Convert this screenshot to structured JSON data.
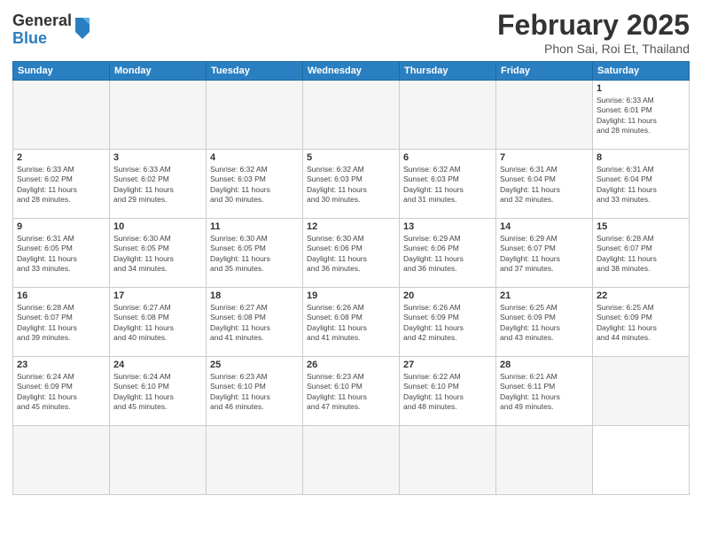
{
  "logo": {
    "general": "General",
    "blue": "Blue"
  },
  "title": "February 2025",
  "subtitle": "Phon Sai, Roi Et, Thailand",
  "weekdays": [
    "Sunday",
    "Monday",
    "Tuesday",
    "Wednesday",
    "Thursday",
    "Friday",
    "Saturday"
  ],
  "days": [
    {
      "num": "",
      "info": ""
    },
    {
      "num": "",
      "info": ""
    },
    {
      "num": "",
      "info": ""
    },
    {
      "num": "",
      "info": ""
    },
    {
      "num": "",
      "info": ""
    },
    {
      "num": "",
      "info": ""
    },
    {
      "num": "1",
      "info": "Sunrise: 6:33 AM\nSunset: 6:01 PM\nDaylight: 11 hours\nand 28 minutes."
    },
    {
      "num": "2",
      "info": "Sunrise: 6:33 AM\nSunset: 6:02 PM\nDaylight: 11 hours\nand 28 minutes."
    },
    {
      "num": "3",
      "info": "Sunrise: 6:33 AM\nSunset: 6:02 PM\nDaylight: 11 hours\nand 29 minutes."
    },
    {
      "num": "4",
      "info": "Sunrise: 6:32 AM\nSunset: 6:03 PM\nDaylight: 11 hours\nand 30 minutes."
    },
    {
      "num": "5",
      "info": "Sunrise: 6:32 AM\nSunset: 6:03 PM\nDaylight: 11 hours\nand 30 minutes."
    },
    {
      "num": "6",
      "info": "Sunrise: 6:32 AM\nSunset: 6:03 PM\nDaylight: 11 hours\nand 31 minutes."
    },
    {
      "num": "7",
      "info": "Sunrise: 6:31 AM\nSunset: 6:04 PM\nDaylight: 11 hours\nand 32 minutes."
    },
    {
      "num": "8",
      "info": "Sunrise: 6:31 AM\nSunset: 6:04 PM\nDaylight: 11 hours\nand 33 minutes."
    },
    {
      "num": "9",
      "info": "Sunrise: 6:31 AM\nSunset: 6:05 PM\nDaylight: 11 hours\nand 33 minutes."
    },
    {
      "num": "10",
      "info": "Sunrise: 6:30 AM\nSunset: 6:05 PM\nDaylight: 11 hours\nand 34 minutes."
    },
    {
      "num": "11",
      "info": "Sunrise: 6:30 AM\nSunset: 6:05 PM\nDaylight: 11 hours\nand 35 minutes."
    },
    {
      "num": "12",
      "info": "Sunrise: 6:30 AM\nSunset: 6:06 PM\nDaylight: 11 hours\nand 36 minutes."
    },
    {
      "num": "13",
      "info": "Sunrise: 6:29 AM\nSunset: 6:06 PM\nDaylight: 11 hours\nand 36 minutes."
    },
    {
      "num": "14",
      "info": "Sunrise: 6:29 AM\nSunset: 6:07 PM\nDaylight: 11 hours\nand 37 minutes."
    },
    {
      "num": "15",
      "info": "Sunrise: 6:28 AM\nSunset: 6:07 PM\nDaylight: 11 hours\nand 38 minutes."
    },
    {
      "num": "16",
      "info": "Sunrise: 6:28 AM\nSunset: 6:07 PM\nDaylight: 11 hours\nand 39 minutes."
    },
    {
      "num": "17",
      "info": "Sunrise: 6:27 AM\nSunset: 6:08 PM\nDaylight: 11 hours\nand 40 minutes."
    },
    {
      "num": "18",
      "info": "Sunrise: 6:27 AM\nSunset: 6:08 PM\nDaylight: 11 hours\nand 41 minutes."
    },
    {
      "num": "19",
      "info": "Sunrise: 6:26 AM\nSunset: 6:08 PM\nDaylight: 11 hours\nand 41 minutes."
    },
    {
      "num": "20",
      "info": "Sunrise: 6:26 AM\nSunset: 6:09 PM\nDaylight: 11 hours\nand 42 minutes."
    },
    {
      "num": "21",
      "info": "Sunrise: 6:25 AM\nSunset: 6:09 PM\nDaylight: 11 hours\nand 43 minutes."
    },
    {
      "num": "22",
      "info": "Sunrise: 6:25 AM\nSunset: 6:09 PM\nDaylight: 11 hours\nand 44 minutes."
    },
    {
      "num": "23",
      "info": "Sunrise: 6:24 AM\nSunset: 6:09 PM\nDaylight: 11 hours\nand 45 minutes."
    },
    {
      "num": "24",
      "info": "Sunrise: 6:24 AM\nSunset: 6:10 PM\nDaylight: 11 hours\nand 45 minutes."
    },
    {
      "num": "25",
      "info": "Sunrise: 6:23 AM\nSunset: 6:10 PM\nDaylight: 11 hours\nand 46 minutes."
    },
    {
      "num": "26",
      "info": "Sunrise: 6:23 AM\nSunset: 6:10 PM\nDaylight: 11 hours\nand 47 minutes."
    },
    {
      "num": "27",
      "info": "Sunrise: 6:22 AM\nSunset: 6:10 PM\nDaylight: 11 hours\nand 48 minutes."
    },
    {
      "num": "28",
      "info": "Sunrise: 6:21 AM\nSunset: 6:11 PM\nDaylight: 11 hours\nand 49 minutes."
    },
    {
      "num": "",
      "info": ""
    },
    {
      "num": "",
      "info": ""
    },
    {
      "num": "",
      "info": ""
    },
    {
      "num": "",
      "info": ""
    },
    {
      "num": "",
      "info": ""
    },
    {
      "num": "",
      "info": ""
    },
    {
      "num": "",
      "info": ""
    }
  ]
}
